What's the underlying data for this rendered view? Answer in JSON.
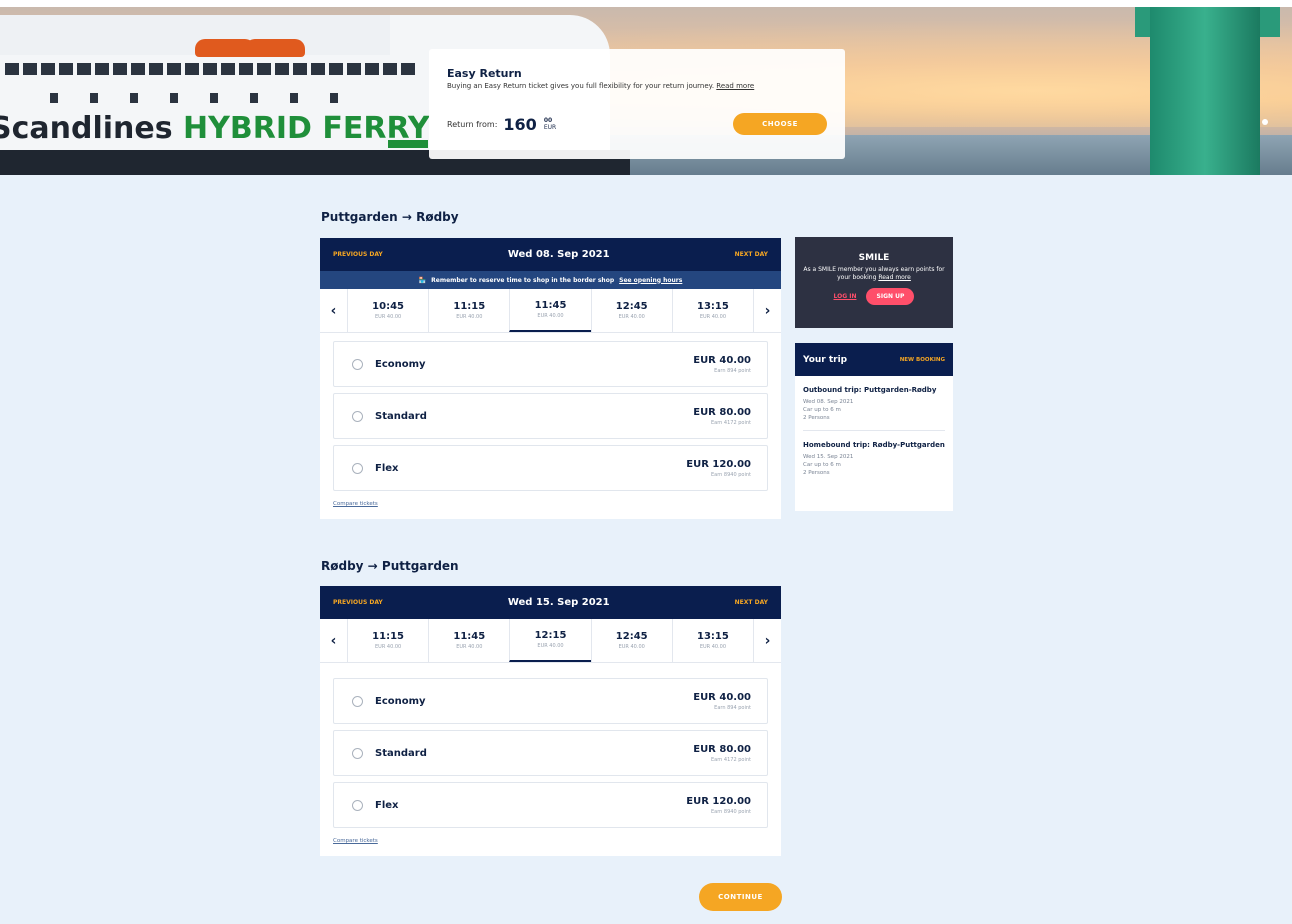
{
  "hero": {
    "ship_brand_dark": "Scandlines",
    "ship_brand_green": "HYBRID FERRY",
    "card": {
      "title": "Easy Return",
      "description": "Buying an Easy Return ticket gives you full flexibility for your return journey.",
      "read_more": "Read more",
      "return_from_label": "Return from:",
      "price": "160",
      "price_cents": "00",
      "currency": "EUR",
      "choose_label": "CHOOSE"
    }
  },
  "outbound": {
    "title": "Puttgarden → Rødby",
    "prev_day": "PREVIOUS DAY",
    "date": "Wed 08. Sep 2021",
    "next_day": "NEXT DAY",
    "banner_text": "Remember to reserve time to shop in the border shop",
    "banner_link": "See opening hours",
    "times": [
      {
        "time": "10:45",
        "price": "EUR 40.00"
      },
      {
        "time": "11:15",
        "price": "EUR 40.00"
      },
      {
        "time": "11:45",
        "price": "EUR 40.00"
      },
      {
        "time": "12:45",
        "price": "EUR 40.00"
      },
      {
        "time": "13:15",
        "price": "EUR 40.00"
      }
    ],
    "fares": [
      {
        "name": "Economy",
        "price": "EUR 40.00",
        "points": "Earn 894 point"
      },
      {
        "name": "Standard",
        "price": "EUR 80.00",
        "points": "Earn 4172 point"
      },
      {
        "name": "Flex",
        "price": "EUR 120.00",
        "points": "Earn 8940 point"
      }
    ],
    "compare": "Compare tickets"
  },
  "homebound": {
    "title": "Rødby → Puttgarden",
    "prev_day": "PREVIOUS DAY",
    "date": "Wed 15. Sep 2021",
    "next_day": "NEXT DAY",
    "times": [
      {
        "time": "11:15",
        "price": "EUR 40.00"
      },
      {
        "time": "11:45",
        "price": "EUR 40.00"
      },
      {
        "time": "12:15",
        "price": "EUR 40.00"
      },
      {
        "time": "12:45",
        "price": "EUR 40.00"
      },
      {
        "time": "13:15",
        "price": "EUR 40.00"
      }
    ],
    "fares": [
      {
        "name": "Economy",
        "price": "EUR 40.00",
        "points": "Earn 894 point"
      },
      {
        "name": "Standard",
        "price": "EUR 80.00",
        "points": "Earn 4172 point"
      },
      {
        "name": "Flex",
        "price": "EUR 120.00",
        "points": "Earn 8940 point"
      }
    ],
    "compare": "Compare tickets"
  },
  "smile": {
    "title": "SMILE",
    "text": "As a SMILE member you always earn points for your booking",
    "read_more": "Read more",
    "login": "LOG IN",
    "signup": "SIGN UP"
  },
  "your_trip": {
    "title": "Your trip",
    "new_booking": "NEW BOOKING",
    "outbound_title": "Outbound trip: Puttgarden-Rødby",
    "outbound_date": "Wed 08. Sep 2021",
    "outbound_vehicle": "Car up to 6 m",
    "outbound_persons": "2 Persons",
    "homebound_title": "Homebound trip: Rødby-Puttgarden",
    "homebound_date": "Wed 15. Sep 2021",
    "homebound_vehicle": "Car up to 6 m",
    "homebound_persons": "2 Persons"
  },
  "continue_label": "CONTINUE",
  "colors": {
    "navy": "#0a1e4e",
    "accent_orange": "#f5a623",
    "smile_pink": "#ff4f6a",
    "page_bg": "#e8f1fa"
  }
}
